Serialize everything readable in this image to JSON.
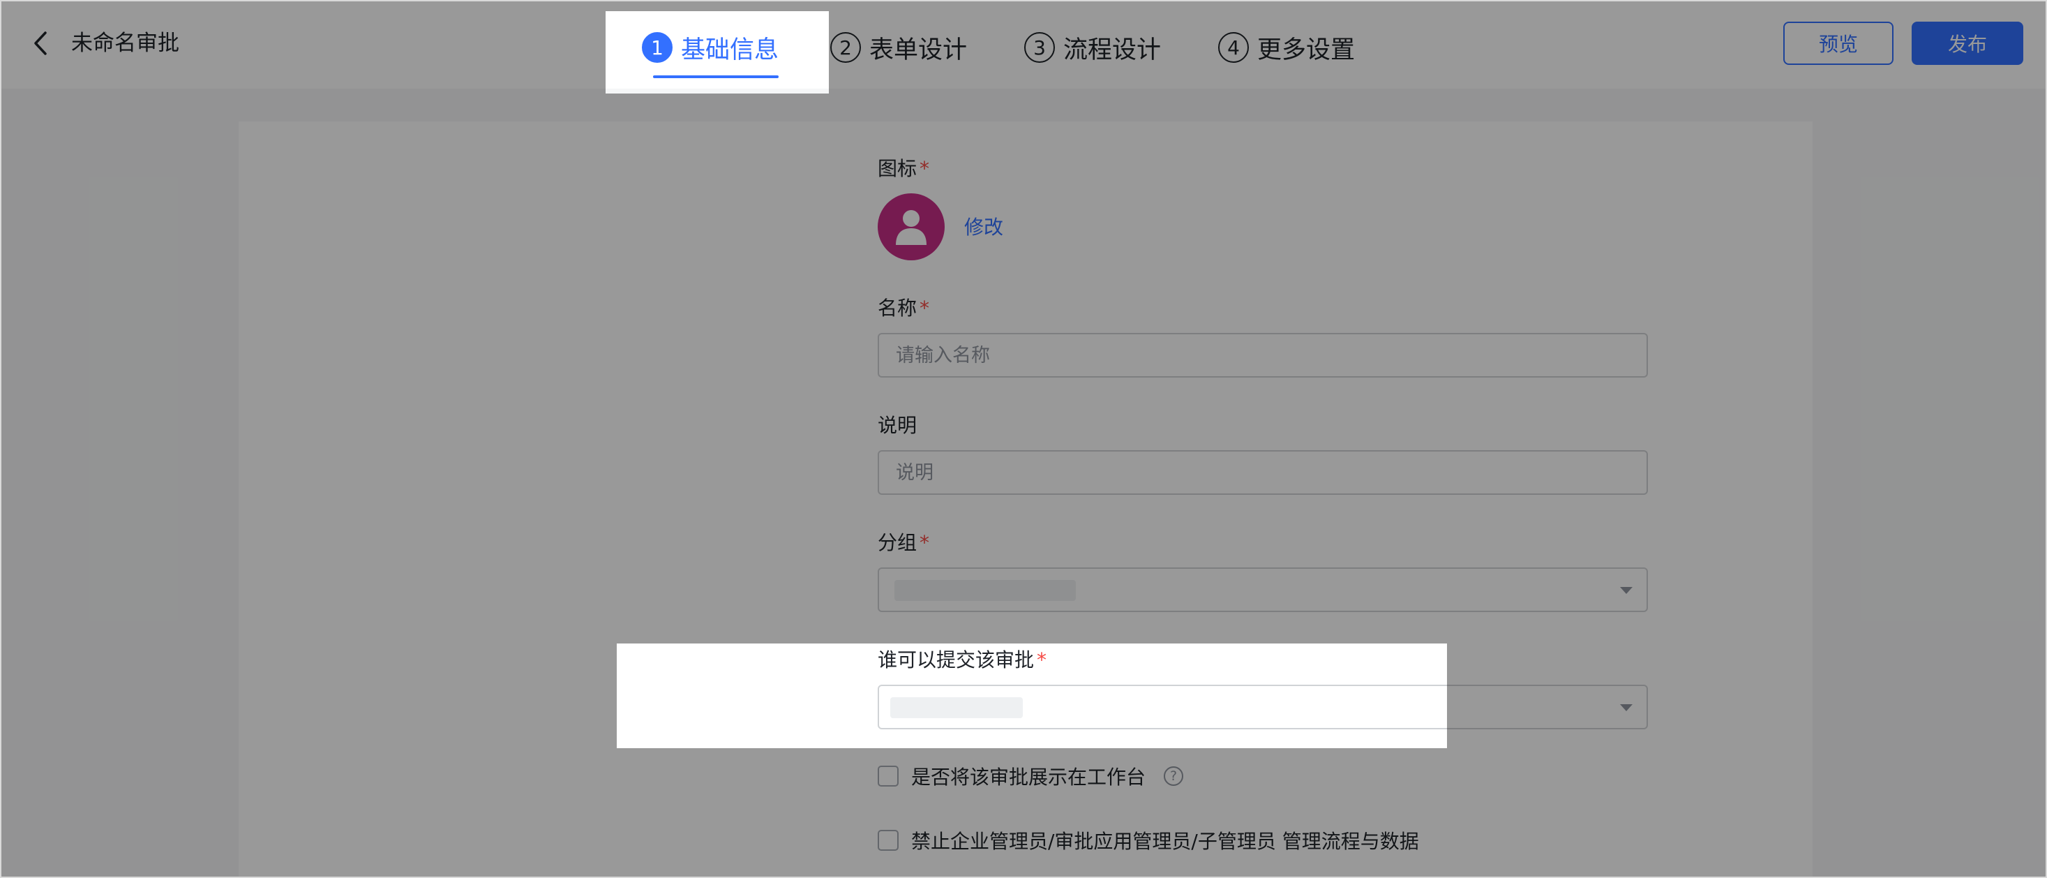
{
  "header": {
    "title": "未命名审批",
    "steps": [
      {
        "num": "1",
        "label": "基础信息"
      },
      {
        "num": "2",
        "label": "表单设计"
      },
      {
        "num": "3",
        "label": "流程设计"
      },
      {
        "num": "4",
        "label": "更多设置"
      }
    ],
    "active_step": 0,
    "preview_label": "预览",
    "publish_label": "发布"
  },
  "form": {
    "icon_label": "图标",
    "modify_label": "修改",
    "name_label": "名称",
    "name_placeholder": "请输入名称",
    "desc_label": "说明",
    "desc_placeholder": "说明",
    "group_label": "分组",
    "submitter_label": "谁可以提交该审批",
    "required_mark": "*",
    "show_on_workbench": "是否将该审批展示在工作台",
    "help_mark": "?",
    "forbid_admin": "禁止企业管理员/审批应用管理员/子管理员 管理流程与数据"
  },
  "colors": {
    "accent": "#3370ff",
    "required": "#f54a45",
    "avatar": "#c52d86"
  }
}
